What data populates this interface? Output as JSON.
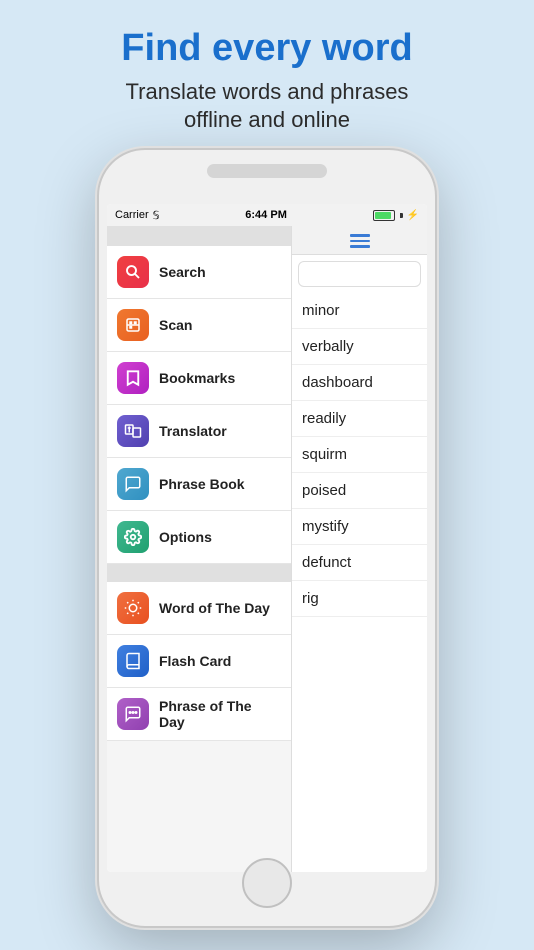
{
  "header": {
    "headline": "Find every word",
    "subheadline_line1": "Translate words and phrases",
    "subheadline_line2": "offline and online"
  },
  "statusBar": {
    "carrier": "Carrier",
    "time": "6:44 PM",
    "wifi": "▲",
    "battery_label": "battery"
  },
  "sidebar": {
    "mainItems": [
      {
        "id": "search",
        "label": "Search",
        "icon": "🔍",
        "iconClass": "icon-search"
      },
      {
        "id": "scan",
        "label": "Scan",
        "icon": "📷",
        "iconClass": "icon-scan"
      },
      {
        "id": "bookmarks",
        "label": "Bookmarks",
        "icon": "🔖",
        "iconClass": "icon-bookmarks"
      },
      {
        "id": "translator",
        "label": "Translator",
        "icon": "📋",
        "iconClass": "icon-translator"
      },
      {
        "id": "phrasebook",
        "label": "Phrase Book",
        "icon": "💬",
        "iconClass": "icon-phrasebook"
      },
      {
        "id": "options",
        "label": "Options",
        "icon": "⚙",
        "iconClass": "icon-options"
      }
    ],
    "secondaryItems": [
      {
        "id": "wordofday",
        "label": "Word of The Day",
        "icon": "☀",
        "iconClass": "icon-wordofday"
      },
      {
        "id": "flashcard",
        "label": "Flash Card",
        "icon": "🗂",
        "iconClass": "icon-flashcard"
      },
      {
        "id": "phraseofday",
        "label": "Phrase of The Day",
        "icon": "💭",
        "iconClass": "icon-phraseofday"
      }
    ]
  },
  "wordList": {
    "words": [
      "minor",
      "verbally",
      "dashboard",
      "readily",
      "squirm",
      "poised",
      "mystify",
      "defunct",
      "rig"
    ]
  },
  "icons": {
    "hamburger": "hamburger-menu",
    "search": "search"
  }
}
